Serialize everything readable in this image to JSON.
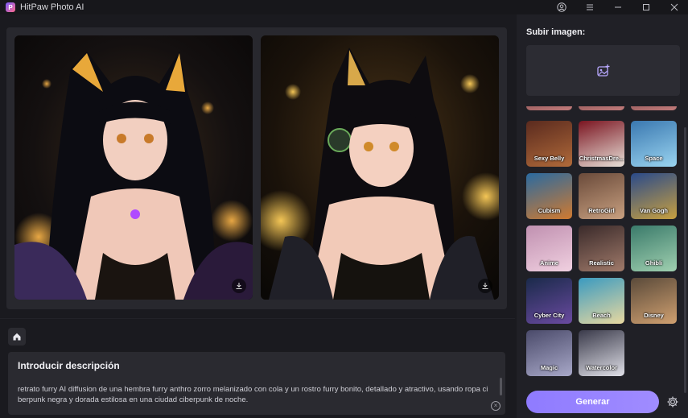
{
  "app": {
    "title": "HitPaw Photo AI",
    "logo_glyph": "P"
  },
  "window_controls": [
    "user-icon",
    "menu-icon",
    "minimize-icon",
    "maximize-icon",
    "close-icon"
  ],
  "viewer": {
    "original_download_icon": "download-icon",
    "result_download_icon": "download-icon"
  },
  "description": {
    "title": "Introducir descripción",
    "text": "retrato furry AI diffusion de una hembra furry anthro zorro melanizado con cola y un rostro furry bonito, detallado y atractivo, usando ropa ci berpunk negra y dorada estilosa en una ciudad ciberpunk de noche.",
    "clear_glyph": "×"
  },
  "sidebar": {
    "upload_title": "Subir imagen:",
    "styles": [
      {
        "label": "Sexy Belly",
        "colors": [
          "#5a2a1e",
          "#b06a3a"
        ]
      },
      {
        "label": "ChristmasDre...",
        "colors": [
          "#7a1420",
          "#e8e0d8"
        ]
      },
      {
        "label": "Space",
        "colors": [
          "#3a78b0",
          "#9ad4f0"
        ]
      },
      {
        "label": "Cubism",
        "colors": [
          "#2a6aa0",
          "#d07a30"
        ]
      },
      {
        "label": "RetroGirl",
        "colors": [
          "#6a4a3a",
          "#c8a080"
        ]
      },
      {
        "label": "Van Gogh",
        "colors": [
          "#2a4a8a",
          "#c8a040"
        ]
      },
      {
        "label": "Anime",
        "colors": [
          "#c090b0",
          "#f0d0e0"
        ]
      },
      {
        "label": "Realistic",
        "colors": [
          "#3a2a2a",
          "#a07a6a"
        ]
      },
      {
        "label": "Ghibli",
        "colors": [
          "#3a7a6a",
          "#a0d0b0"
        ]
      },
      {
        "label": "Cyber City",
        "colors": [
          "#1a2a4a",
          "#6a4aa0"
        ]
      },
      {
        "label": "Beach",
        "colors": [
          "#3a9ac0",
          "#e8d8a0"
        ]
      },
      {
        "label": "Disney",
        "colors": [
          "#5a4a3a",
          "#d0a070"
        ]
      },
      {
        "label": "Magic",
        "colors": [
          "#4a4a6a",
          "#a8a8c8"
        ]
      },
      {
        "label": "Watercolor",
        "colors": [
          "#3a3a4a",
          "#e0e0e8"
        ]
      }
    ],
    "generate_label": "Generar"
  },
  "colors": {
    "accent": "#8f7bff",
    "background": "#1a1a1f",
    "panel": "#28282e",
    "sidebar": "#202026"
  }
}
